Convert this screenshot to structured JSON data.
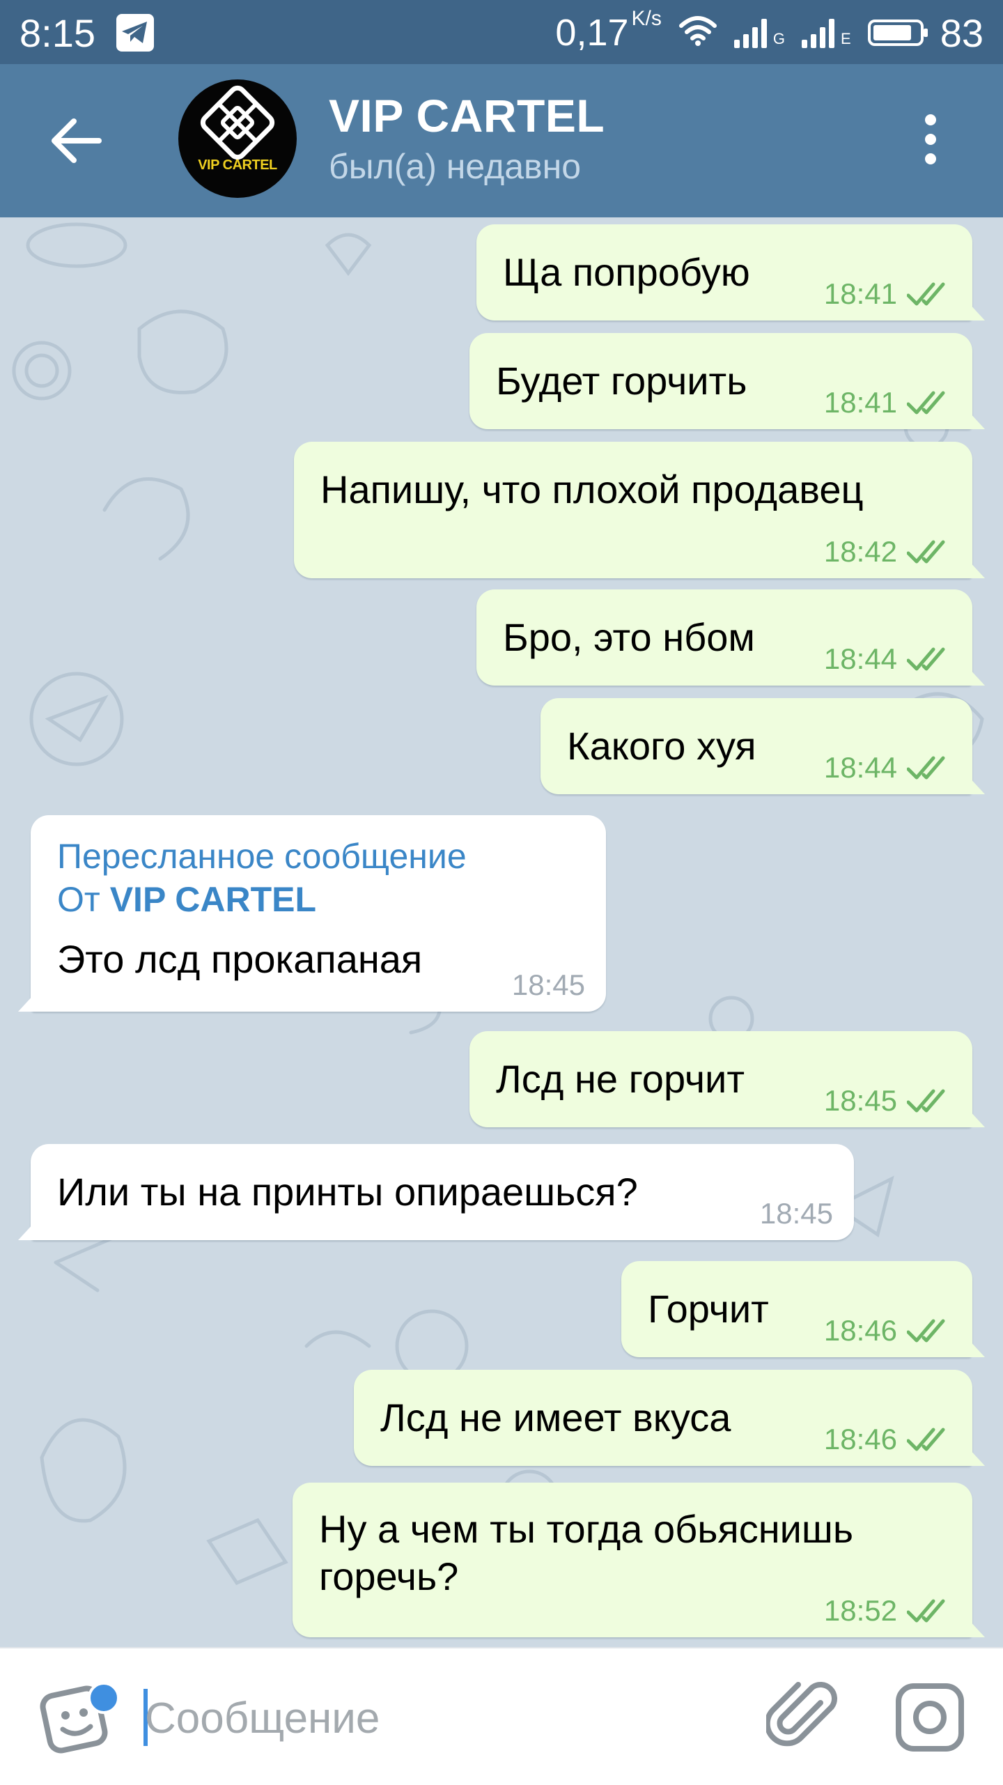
{
  "status_bar": {
    "time": "8:15",
    "net_speed": "0,17",
    "net_unit": "K/s",
    "sim1_type": "G",
    "sim2_type": "E",
    "battery": "83"
  },
  "header": {
    "title": "VIP CARTEL",
    "status": "был(а) недавно",
    "avatar_text": "VIP CARTEL"
  },
  "messages": [
    {
      "dir": "out",
      "text": "Ща попробую",
      "time": "18:41",
      "read": true
    },
    {
      "dir": "out",
      "text": "Будет горчить",
      "time": "18:41",
      "read": true
    },
    {
      "dir": "out",
      "text": "Напишу, что плохой продавец",
      "time": "18:42",
      "read": true
    },
    {
      "dir": "out",
      "text": "Бро, это нбом",
      "time": "18:44",
      "read": true
    },
    {
      "dir": "out",
      "text": "Какого хуя",
      "time": "18:44",
      "read": true
    },
    {
      "dir": "in",
      "forwarded_label": "Пересланное сообщение",
      "forwarded_from_prefix": "От",
      "forwarded_from": "VIP CARTEL",
      "text": "Это лсд прокапаная",
      "time": "18:45"
    },
    {
      "dir": "out",
      "text": "Лсд не горчит",
      "time": "18:45",
      "read": true
    },
    {
      "dir": "in",
      "text": "Или ты на принты опираешься?",
      "time": "18:45"
    },
    {
      "dir": "out",
      "text": "Горчит",
      "time": "18:46",
      "read": true
    },
    {
      "dir": "out",
      "text": "Лсд не имеет вкуса",
      "time": "18:46",
      "read": true
    },
    {
      "dir": "out",
      "text_line1": "Ну а чем ты тогда обьяснишь",
      "text_line2": "горечь?",
      "time": "18:52",
      "read": true
    }
  ],
  "input": {
    "placeholder": "Сообщение",
    "value": ""
  },
  "colors": {
    "header_bg": "#517da2",
    "status_bar_bg": "#3f6588",
    "outgoing_bubble": "#effdde",
    "incoming_bubble": "#ffffff",
    "read_ticks": "#6db566",
    "forward_link": "#3a86c7"
  },
  "icons": {
    "back": "arrow-left-icon",
    "menu": "more-vertical-icon",
    "sticker": "sticker-icon",
    "attach": "paperclip-icon",
    "camera": "instagram-camera-icon",
    "telegram_notification": "telegram-icon",
    "wifi": "wifi-icon"
  }
}
